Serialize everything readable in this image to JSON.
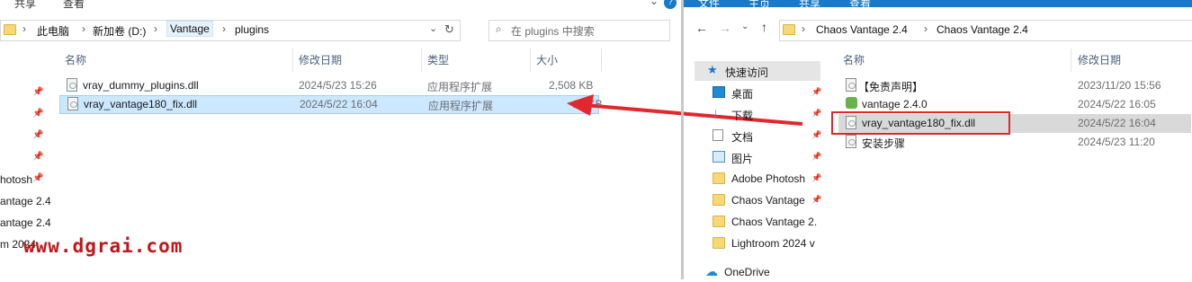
{
  "left": {
    "ribbon": {
      "tab_share": "共享",
      "tab_view": "查看"
    },
    "breadcrumb": [
      "此电脑",
      "新加卷 (D:)",
      "Vantage",
      "plugins"
    ],
    "search_placeholder": "在 plugins 中搜索",
    "columns": {
      "name": "名称",
      "date": "修改日期",
      "type": "类型",
      "size": "大小"
    },
    "files": [
      {
        "name": "vray_dummy_plugins.dll",
        "date": "2024/5/23 15:26",
        "type": "应用程序扩展",
        "size": "2,508 KB"
      },
      {
        "name": "vray_vantage180_fix.dll",
        "date": "2024/5/22 16:04",
        "type": "应用程序扩展",
        "size": "24 KB"
      }
    ],
    "nav_truncated": [
      "hotosh",
      "antage 2.4",
      "antage 2.4",
      "m 2024"
    ]
  },
  "watermark": "www.dgrai.com",
  "right": {
    "ribbon": {
      "tab_file": "文件",
      "tab_home": "主页",
      "tab_share": "共享",
      "tab_view": "查看"
    },
    "breadcrumb": [
      "Chaos Vantage 2.4",
      "Chaos Vantage 2.4"
    ],
    "nav": {
      "quick_access": "快速访问",
      "items": [
        "桌面",
        "下载",
        "文档",
        "图片",
        "Adobe Photosh",
        "Chaos Vantage",
        "Chaos Vantage 2.",
        "Lightroom 2024 v"
      ],
      "onedrive": "OneDrive"
    },
    "columns": {
      "name": "名称",
      "date": "修改日期"
    },
    "files": [
      {
        "name": "【免责声明】",
        "date": "2023/11/20 15:56"
      },
      {
        "name": "vantage 2.4.0",
        "date": "2024/5/22 16:05"
      },
      {
        "name": "vray_vantage180_fix.dll",
        "date": "2024/5/22 16:04"
      },
      {
        "name": "安装步骤",
        "date": "2024/5/23 11:20"
      }
    ]
  },
  "colors": {
    "accent": "#1979ca",
    "highlight_red": "#e0282e",
    "selection": "#cce8ff"
  }
}
